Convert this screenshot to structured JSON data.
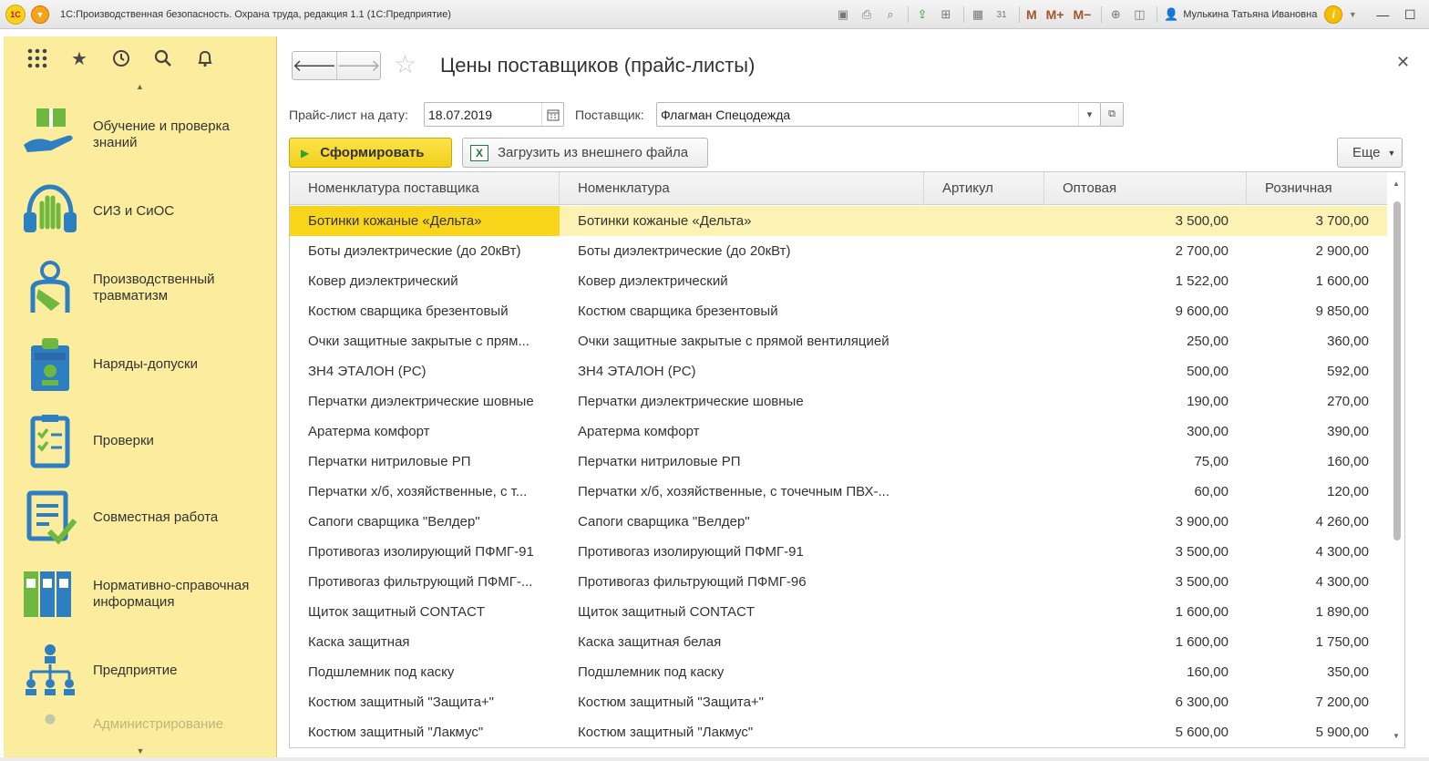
{
  "window": {
    "title": "1С:Производственная безопасность. Охрана труда, редакция 1.1  (1С:Предприятие)",
    "logo_text": "1С",
    "user": "Мулькина Татьяна Ивановна",
    "mem_labels": [
      "M",
      "M+",
      "M−"
    ]
  },
  "sidebar": {
    "items": [
      {
        "label": "Обучение и проверка знаний",
        "icon": "training-icon"
      },
      {
        "label": "СИЗ и СиОС",
        "icon": "ppe-icon"
      },
      {
        "label": "Производственный травматизм",
        "icon": "injury-icon"
      },
      {
        "label": "Наряды-допуски",
        "icon": "permit-icon"
      },
      {
        "label": "Проверки",
        "icon": "checklist-icon"
      },
      {
        "label": "Совместная работа",
        "icon": "collaboration-icon"
      },
      {
        "label": "Нормативно-справочная информация",
        "icon": "binders-icon"
      },
      {
        "label": "Предприятие",
        "icon": "org-structure-icon"
      },
      {
        "label": "Администрирование",
        "icon": "admin-icon"
      }
    ]
  },
  "form": {
    "title": "Цены поставщиков (прайс-листы)",
    "date_label": "Прайс-лист на дату:",
    "date_value": "18.07.2019",
    "supplier_label": "Поставщик:",
    "supplier_value": "Флагман Спецодежда",
    "generate_label": "Сформировать",
    "load_label": "Загрузить из внешнего файла",
    "more_label": "Еще"
  },
  "table": {
    "columns": [
      "Номенклатура поставщика",
      "Номенклатура",
      "Артикул",
      "Оптовая",
      "Розничная"
    ],
    "rows": [
      {
        "supplier_item": "Ботинки кожаные «Дельта»",
        "item": "Ботинки кожаные «Дельта»",
        "sku": "",
        "wholesale": "3 500,00",
        "retail": "3 700,00"
      },
      {
        "supplier_item": "Боты диэлектрические (до 20кВт)",
        "item": "Боты диэлектрические (до 20кВт)",
        "sku": "",
        "wholesale": "2 700,00",
        "retail": "2 900,00"
      },
      {
        "supplier_item": "Ковер диэлектрический",
        "item": "Ковер диэлектрический",
        "sku": "",
        "wholesale": "1 522,00",
        "retail": "1 600,00"
      },
      {
        "supplier_item": "Костюм сварщика брезентовый",
        "item": "Костюм сварщика брезентовый",
        "sku": "",
        "wholesale": "9 600,00",
        "retail": "9 850,00"
      },
      {
        "supplier_item": "Очки защитные закрытые с прям...",
        "item": "Очки защитные закрытые с прямой вентиляцией",
        "sku": "",
        "wholesale": "250,00",
        "retail": "360,00"
      },
      {
        "supplier_item": "ЗН4 ЭТАЛОН (PC)",
        "item": "ЗН4 ЭТАЛОН (PC)",
        "sku": "",
        "wholesale": "500,00",
        "retail": "592,00"
      },
      {
        "supplier_item": "Перчатки диэлектрические шовные",
        "item": "Перчатки диэлектрические шовные",
        "sku": "",
        "wholesale": "190,00",
        "retail": "270,00"
      },
      {
        "supplier_item": "Аратерма комфорт",
        "item": "Аратерма комфорт",
        "sku": "",
        "wholesale": "300,00",
        "retail": "390,00"
      },
      {
        "supplier_item": "Перчатки нитриловые РП",
        "item": "Перчатки нитриловые РП",
        "sku": "",
        "wholesale": "75,00",
        "retail": "160,00"
      },
      {
        "supplier_item": "Перчатки х/б, хозяйственные, с т...",
        "item": "Перчатки х/б, хозяйственные, с точечным ПВХ-...",
        "sku": "",
        "wholesale": "60,00",
        "retail": "120,00"
      },
      {
        "supplier_item": "Сапоги сварщика \"Велдер\"",
        "item": "Сапоги сварщика \"Велдер\"",
        "sku": "",
        "wholesale": "3 900,00",
        "retail": "4 260,00"
      },
      {
        "supplier_item": "Противогаз изолирующий ПФМГ-91",
        "item": "Противогаз изолирующий ПФМГ-91",
        "sku": "",
        "wholesale": "3 500,00",
        "retail": "4 300,00"
      },
      {
        "supplier_item": "Противогаз фильтрующий ПФМГ-...",
        "item": "Противогаз фильтрующий ПФМГ-96",
        "sku": "",
        "wholesale": "3 500,00",
        "retail": "4 300,00"
      },
      {
        "supplier_item": "Щиток защитный CONTACT",
        "item": "Щиток защитный CONTACT",
        "sku": "",
        "wholesale": "1 600,00",
        "retail": "1 890,00"
      },
      {
        "supplier_item": "Каска защитная",
        "item": "Каска защитная белая",
        "sku": "",
        "wholesale": "1 600,00",
        "retail": "1 750,00"
      },
      {
        "supplier_item": "Подшлемник под каску",
        "item": "Подшлемник под каску",
        "sku": "",
        "wholesale": "160,00",
        "retail": "350,00"
      },
      {
        "supplier_item": "Костюм защитный \"Защита+\"",
        "item": "Костюм защитный \"Защита+\"",
        "sku": "",
        "wholesale": "6 300,00",
        "retail": "7 200,00"
      },
      {
        "supplier_item": "Костюм защитный \"Лакмус\"",
        "item": "Костюм защитный \"Лакмус\"",
        "sku": "",
        "wholesale": "5 600,00",
        "retail": "5 900,00"
      }
    ]
  },
  "colors": {
    "sidebar_bg": "#fbec9e",
    "accent_yellow": "#f8d41a",
    "selected_row": "#fcf2b4",
    "icon_blue": "#2d7fc2",
    "icon_green": "#4caf50"
  }
}
